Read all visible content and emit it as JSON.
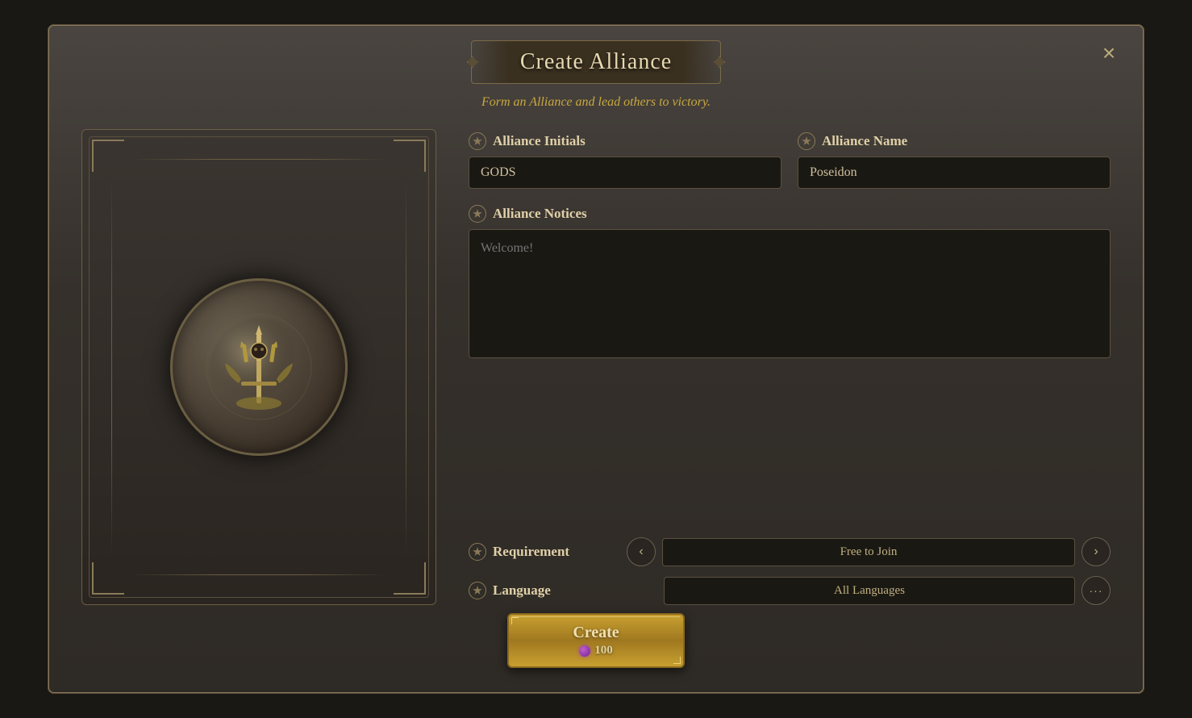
{
  "modal": {
    "title": "Create Alliance",
    "subtitle": "Form an Alliance and lead others to victory.",
    "close_label": "×"
  },
  "form": {
    "alliance_initials_label": "Alliance Initials",
    "alliance_initials_value": "GODS",
    "alliance_name_label": "Alliance Name",
    "alliance_name_value": "Poseidon",
    "alliance_notices_label": "Alliance Notices",
    "alliance_notices_placeholder": "Welcome!",
    "requirement_label": "Requirement",
    "requirement_value": "Free to Join",
    "language_label": "Language",
    "language_value": "All Languages"
  },
  "create_button": {
    "label": "Create",
    "cost": "100"
  },
  "icons": {
    "close": "×",
    "prev_arrow": "‹",
    "next_arrow": "›",
    "dots": "···"
  }
}
